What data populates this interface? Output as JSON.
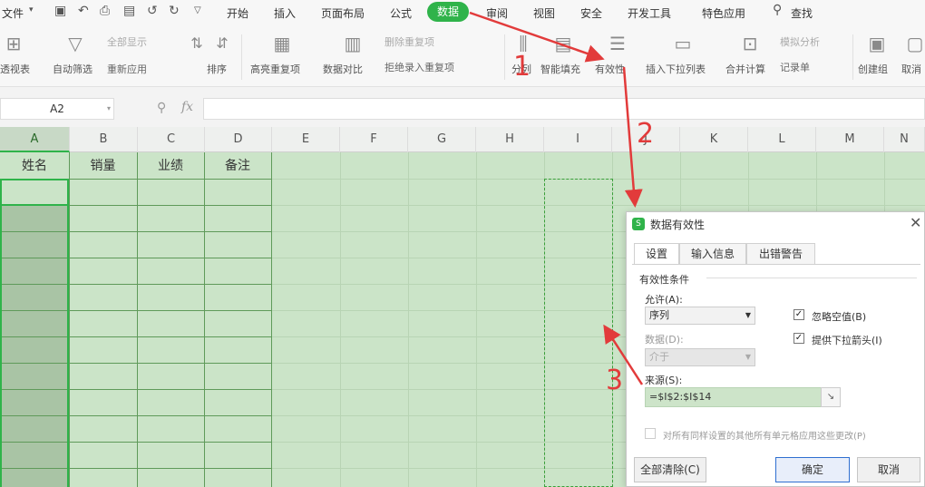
{
  "menubar": {
    "file": "文件",
    "quick_icons": [
      "save-icon",
      "undo-history-icon",
      "print-icon",
      "print-preview-icon",
      "undo-icon",
      "redo-icon",
      "customize-icon"
    ],
    "tabs": [
      "开始",
      "插入",
      "页面布局",
      "公式",
      "数据",
      "审阅",
      "视图",
      "安全",
      "开发工具",
      "特色应用"
    ],
    "active_tab": "数据",
    "search": "查找"
  },
  "ribbon": {
    "pivot": "透视表",
    "auto_filter": "自动筛选",
    "show_all": "全部显示",
    "reapply": "重新应用",
    "sort": "排序",
    "highlight_dup": "高亮重复项",
    "data_compare": "数据对比",
    "remove_dup": "删除重复项",
    "reject_dup": "拒绝录入重复项",
    "split": "分列",
    "smart_fill": "智能填充",
    "validity": "有效性",
    "insert_dropdown": "插入下拉列表",
    "consolidate": "合并计算",
    "simulate": "模拟分析",
    "record_form": "记录单",
    "create_group": "创建组",
    "ungroup": "取消"
  },
  "formula_bar": {
    "name_box": "A2",
    "fx": "fx"
  },
  "sheet": {
    "columns": [
      "A",
      "B",
      "C",
      "D",
      "E",
      "F",
      "G",
      "H",
      "I",
      "J",
      "K",
      "L",
      "M",
      "N"
    ],
    "selected_column": "A",
    "header_row": [
      "姓名",
      "销量",
      "业绩",
      "备注"
    ]
  },
  "dialog": {
    "title": "数据有效性",
    "tabs": [
      "设置",
      "输入信息",
      "出错警告"
    ],
    "active_tab": "设置",
    "section": "有效性条件",
    "allow_label": "允许(A):",
    "allow_value": "序列",
    "data_label": "数据(D):",
    "data_value": "介于",
    "ignore_blank": "忽略空值(B)",
    "ignore_blank_checked": true,
    "dropdown_arrow": "提供下拉箭头(I)",
    "dropdown_arrow_checked": true,
    "source_label": "来源(S):",
    "source_value": "=$I$2:$I$14",
    "apply_all": "对所有同样设置的其他所有单元格应用这些更改(P)",
    "clear_all": "全部清除(C)",
    "ok": "确定",
    "cancel": "取消"
  },
  "annotations": [
    "1",
    "2",
    "3"
  ],
  "colors": {
    "accent_green": "#2fb34a",
    "annotation_red": "#e23b3b",
    "sheet_green": "#cbe4c8"
  }
}
